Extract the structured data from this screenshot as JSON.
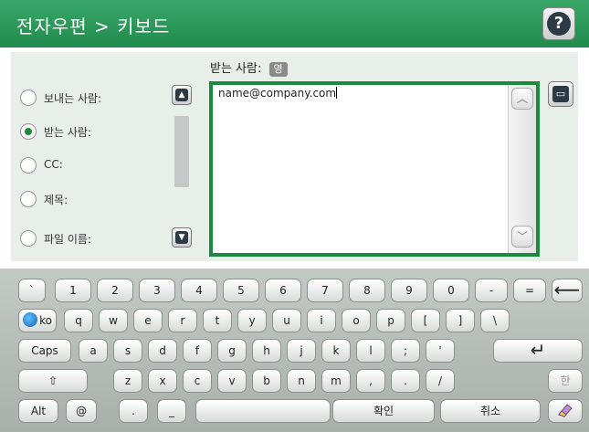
{
  "header": {
    "title": "전자우편 > 키보드",
    "help_icon": "?"
  },
  "to_header": {
    "label": "받는 사람:",
    "lang_badge": "영"
  },
  "fields": [
    {
      "label": "보내는 사람:",
      "selected": false
    },
    {
      "label": "받는 사람:",
      "selected": true
    },
    {
      "label": "CC:",
      "selected": false
    },
    {
      "label": "제목:",
      "selected": false
    },
    {
      "label": "파일 이름:",
      "selected": false
    }
  ],
  "text_area": {
    "value": "name@company.com"
  },
  "icons": {
    "help": "help-icon",
    "scroll_up": "chevron-up-icon",
    "scroll_down": "chevron-down-icon",
    "address_book": "address-book-icon",
    "globe": "globe-icon",
    "shift": "shift-arrow-icon",
    "backspace": "backspace-arrow-icon",
    "enter": "enter-arrow-icon",
    "eraser": "eraser-icon"
  },
  "keyboard": {
    "row1": [
      "`",
      "1",
      "2",
      "3",
      "4",
      "5",
      "6",
      "7",
      "8",
      "9",
      "0",
      "-",
      "="
    ],
    "row1_backspace": "⟵",
    "row2_lang": "ko",
    "row2": [
      "q",
      "w",
      "e",
      "r",
      "t",
      "y",
      "u",
      "i",
      "o",
      "p",
      "[",
      "]",
      "\\"
    ],
    "row3_caps": "Caps",
    "row3": [
      "a",
      "s",
      "d",
      "f",
      "g",
      "h",
      "j",
      "k",
      "l",
      ";",
      "'"
    ],
    "row3_enter": "↵",
    "row4_shift": "⇧",
    "row4": [
      "z",
      "x",
      "c",
      "v",
      "b",
      "n",
      "m",
      ",",
      ".",
      "/"
    ],
    "row4_hangul": "한",
    "row5_alt": "Alt",
    "row5_at": "@",
    "row5_dot": ".",
    "row5_underscore": "_",
    "row5_space": "",
    "row5_ok": "확인",
    "row5_cancel": "취소"
  },
  "colors": {
    "accent": "#1c8a3e",
    "header": "#2a9a5a",
    "panel": "#e8efe9",
    "keyboard": "#b4bbb6"
  }
}
